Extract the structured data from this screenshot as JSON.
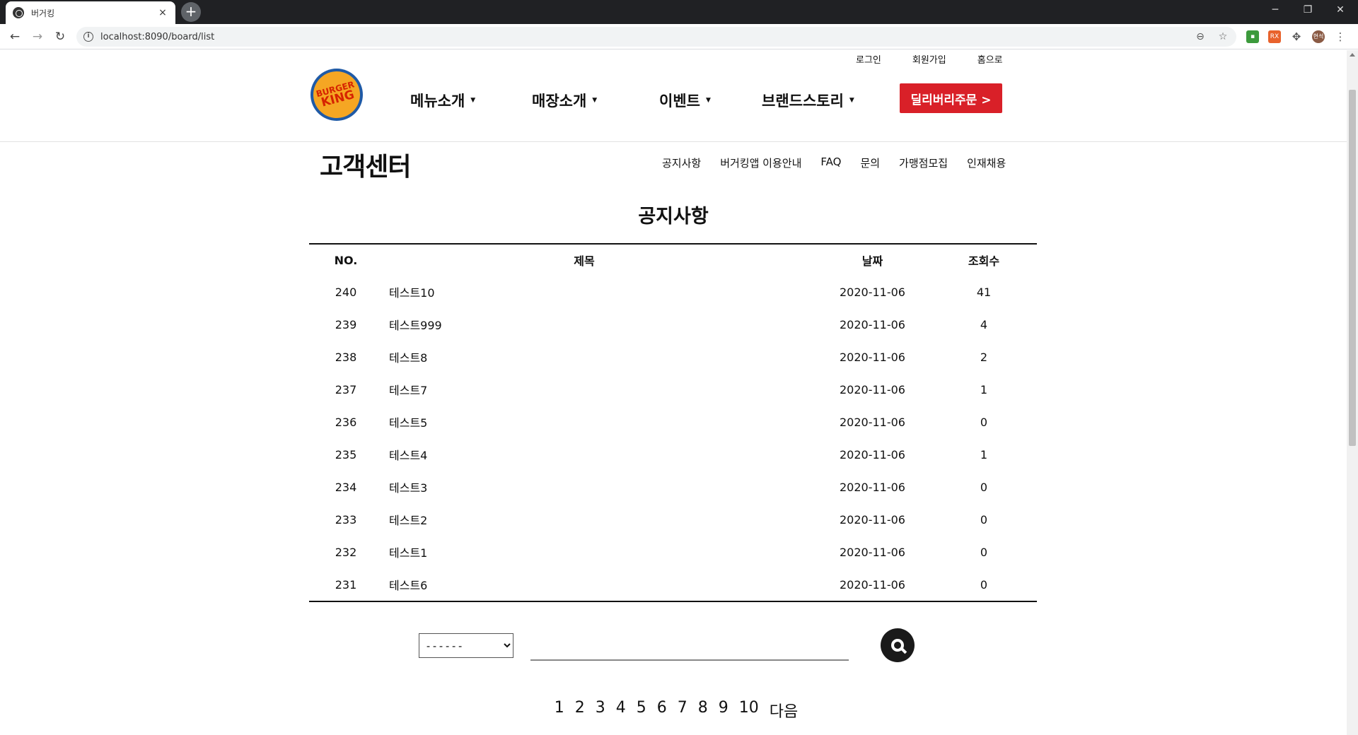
{
  "browser": {
    "tab_title": "버거킹",
    "url": "localhost:8090/board/list",
    "new_tab": "+",
    "close": "×",
    "minimize": "─",
    "restore": "❐",
    "win_close": "✕",
    "profile_initial": "현석",
    "ext_rx_label": "RX"
  },
  "header": {
    "util_links": [
      "로그인",
      "회원가입",
      "홈으로"
    ],
    "logo_line1": "BURGER",
    "logo_line2": "KING",
    "gnb": [
      "메뉴소개",
      "매장소개",
      "이벤트",
      "브랜드스토리"
    ],
    "delivery_button": "딜리버리주문 >"
  },
  "section": {
    "title": "고객센터",
    "lnb": [
      "공지사항",
      "버거킹앱 이용안내",
      "FAQ",
      "문의",
      "가맹점모집",
      "인재채용"
    ]
  },
  "board": {
    "title": "공지사항",
    "columns": {
      "no": "NO.",
      "title": "제목",
      "date": "날짜",
      "views": "조회수"
    },
    "rows": [
      {
        "no": "240",
        "title": "테스트10",
        "date": "2020-11-06",
        "views": "41"
      },
      {
        "no": "239",
        "title": "테스트999",
        "date": "2020-11-06",
        "views": "4"
      },
      {
        "no": "238",
        "title": "테스트8",
        "date": "2020-11-06",
        "views": "2"
      },
      {
        "no": "237",
        "title": "테스트7",
        "date": "2020-11-06",
        "views": "1"
      },
      {
        "no": "236",
        "title": "테스트5",
        "date": "2020-11-06",
        "views": "0"
      },
      {
        "no": "235",
        "title": "테스트4",
        "date": "2020-11-06",
        "views": "1"
      },
      {
        "no": "234",
        "title": "테스트3",
        "date": "2020-11-06",
        "views": "0"
      },
      {
        "no": "233",
        "title": "테스트2",
        "date": "2020-11-06",
        "views": "0"
      },
      {
        "no": "232",
        "title": "테스트1",
        "date": "2020-11-06",
        "views": "0"
      },
      {
        "no": "231",
        "title": "테스트6",
        "date": "2020-11-06",
        "views": "0"
      }
    ]
  },
  "search": {
    "select_value": "------",
    "query": ""
  },
  "pagination": {
    "pages": [
      "1",
      "2",
      "3",
      "4",
      "5",
      "6",
      "7",
      "8",
      "9",
      "10"
    ],
    "next": "다음"
  },
  "colors": {
    "brand_red": "#d92028",
    "logo_blue": "#1f5aa6",
    "logo_bun": "#f5a623"
  }
}
